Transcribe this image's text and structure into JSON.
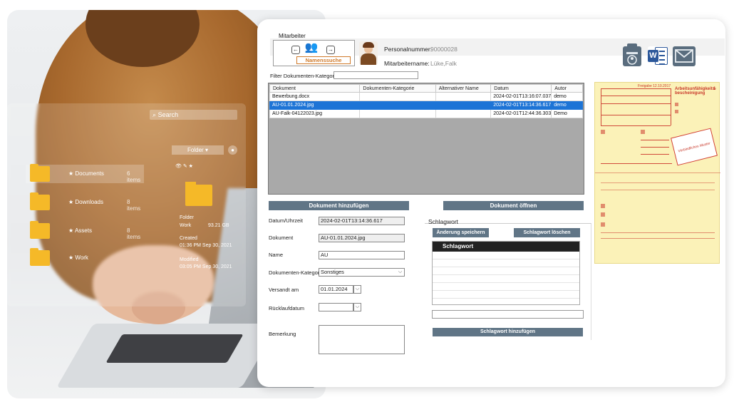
{
  "background": {
    "search_placeholder": "Search",
    "folder_dropdown": "Folder",
    "folders": [
      {
        "name": "Documents",
        "count": "6 items"
      },
      {
        "name": "Downloads",
        "count": "8 items"
      },
      {
        "name": "Assets",
        "count": "8 items"
      },
      {
        "name": "Work",
        "count": ""
      }
    ],
    "detail": {
      "type": "Folder",
      "name": "Work",
      "size": "93.21 GB",
      "created_label": "Created",
      "created_value": "01:36 PM Sep 30, 2021",
      "modified_label": "Modified",
      "modified_value": "03:05 PM Sep 30, 2021"
    }
  },
  "app": {
    "employee": {
      "group_label": "Mitarbeiter",
      "search_button": "Namenssuche",
      "personnel_number_label": "Personalnummer:",
      "personnel_number_value": "90000028",
      "employee_name_label": "Mitarbeitername:",
      "employee_name_value": "Lüke,Falk"
    },
    "filter": {
      "label": "Filter Dokumenten-Kategorie",
      "value": ""
    },
    "table": {
      "columns": [
        "Dokument",
        "Dokumenten-Kategorie",
        "Alternativer Name",
        "Datum",
        "Autor"
      ],
      "rows": [
        [
          "Bewerbung.docx",
          "",
          "",
          "2024-02-01T13:16:07.037",
          "demo"
        ],
        [
          "AU-01.01.2024.jpg",
          "",
          "",
          "2024-02-01T13:14:36.617",
          "demo"
        ],
        [
          "AU-Falk-04122023.jpg",
          "",
          "",
          "2024-02-01T12:44:36.303",
          "Demo"
        ]
      ],
      "selected_row": 1
    },
    "buttons": {
      "add_document": "Dokument hinzufügen",
      "open_document": "Dokument öffnen",
      "save_changes": "Änderung speichern",
      "delete_keyword": "Schlagwort löschen",
      "add_keyword": "Schlagwort hinzufügen"
    },
    "form": {
      "datetime_label": "Datum/Uhrzeit",
      "datetime_value": "2024-02-01T13:14:36.617",
      "document_label": "Dokument",
      "document_value": "AU-01.01.2024.jpg",
      "name_label": "Name",
      "name_value": "AU",
      "category_label": "Dokumenten-Kategorie",
      "category_value": "Sonstiges",
      "sent_label": "Versandt am",
      "sent_value": "01.01.2024",
      "return_label": "Rücklaufdatum",
      "return_value": "",
      "remark_label": "Bemerkung",
      "remark_value": ""
    },
    "keywords": {
      "group_label": "Schlagwort",
      "list_header": "Schlagwort",
      "items": [],
      "input_value": ""
    },
    "preview": {
      "title": "Arbeitsunfähigkeits-bescheinigung",
      "stamp_text": "Verbindliches Muster",
      "release": "Freigabe 12.10.2017",
      "number": "1"
    }
  }
}
